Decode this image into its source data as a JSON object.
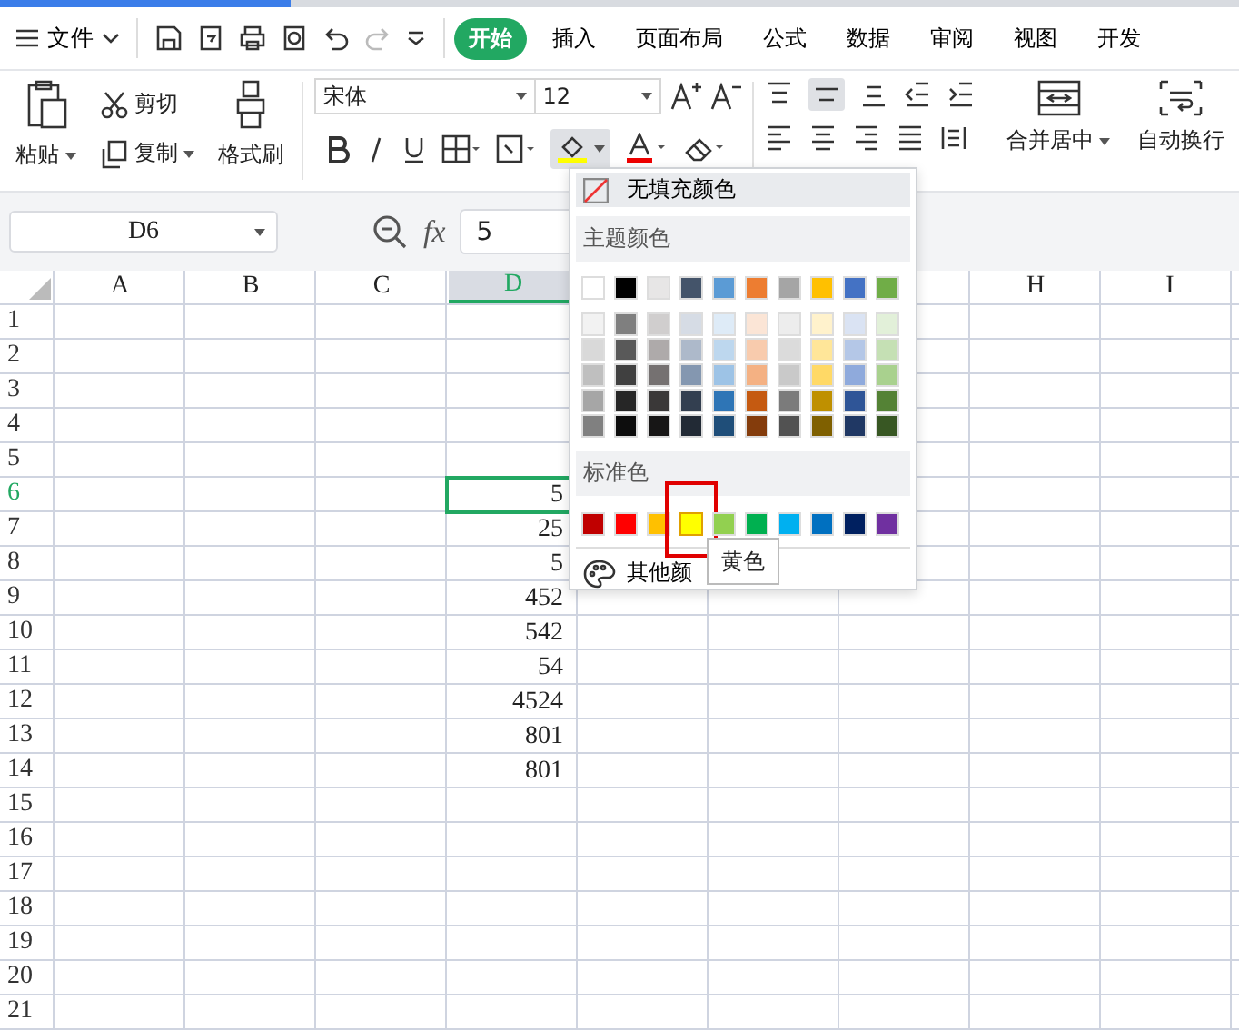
{
  "top_bar": {
    "file_menu": "文件",
    "tabs": [
      {
        "label": "开始",
        "selected": true
      },
      {
        "label": "插入",
        "selected": false
      },
      {
        "label": "页面布局",
        "selected": false
      },
      {
        "label": "公式",
        "selected": false
      },
      {
        "label": "数据",
        "selected": false
      },
      {
        "label": "审阅",
        "selected": false
      },
      {
        "label": "视图",
        "selected": false
      },
      {
        "label": "开发",
        "selected": false
      }
    ]
  },
  "ribbon": {
    "paste": "粘贴",
    "cut": "剪切",
    "copy": "复制",
    "format_painter": "格式刷",
    "font": "宋体",
    "font_size": "12",
    "fill_color_pressed": true,
    "merge": "合并居中",
    "wrap": "自动换行"
  },
  "formula_bar": {
    "cell_ref": "D6",
    "fx": "fx",
    "value": "5"
  },
  "grid": {
    "columns": [
      {
        "label": "A",
        "selected": false
      },
      {
        "label": "B",
        "selected": false
      },
      {
        "label": "C",
        "selected": false
      },
      {
        "label": "D",
        "selected": true
      },
      {
        "label": "H",
        "selected": false
      },
      {
        "label": "I",
        "selected": false
      }
    ],
    "rows": [
      {
        "label": "1",
        "selected": false
      },
      {
        "label": "2",
        "selected": false
      },
      {
        "label": "3",
        "selected": false
      },
      {
        "label": "4",
        "selected": false
      },
      {
        "label": "5",
        "selected": false
      },
      {
        "label": "6",
        "selected": true,
        "d": "5"
      },
      {
        "label": "7",
        "selected": false,
        "d": "25"
      },
      {
        "label": "8",
        "selected": false,
        "d": "5"
      },
      {
        "label": "9",
        "selected": false,
        "d": "452"
      },
      {
        "label": "10",
        "selected": false,
        "d": "542"
      },
      {
        "label": "11",
        "selected": false,
        "d": "54"
      },
      {
        "label": "12",
        "selected": false,
        "d": "4524"
      },
      {
        "label": "13",
        "selected": false,
        "d": "801"
      },
      {
        "label": "14",
        "selected": false,
        "d": "801"
      },
      {
        "label": "15",
        "selected": false
      },
      {
        "label": "16",
        "selected": false
      },
      {
        "label": "17",
        "selected": false
      },
      {
        "label": "18",
        "selected": false
      },
      {
        "label": "19",
        "selected": false
      },
      {
        "label": "20",
        "selected": false
      },
      {
        "label": "21",
        "selected": false
      }
    ]
  },
  "fill_popup": {
    "no_fill": "无填充颜色",
    "theme_heading": "主题颜色",
    "theme_colors": [
      {
        "color": "#ffffff"
      },
      {
        "color": "#000000"
      },
      {
        "color": "#e7e6e6"
      },
      {
        "color": "#44546a"
      },
      {
        "color": "#5b9bd5"
      },
      {
        "color": "#ed7d31"
      },
      {
        "color": "#a5a5a5"
      },
      {
        "color": "#ffc000"
      },
      {
        "color": "#4472c4"
      },
      {
        "color": "#70ad47"
      }
    ],
    "tints": [
      [
        {
          "color": "#f2f2f2"
        },
        {
          "color": "#7f7f7f"
        },
        {
          "color": "#d0cece"
        },
        {
          "color": "#d6dce5"
        },
        {
          "color": "#deebf7"
        },
        {
          "color": "#fbe5d6"
        },
        {
          "color": "#ededed"
        },
        {
          "color": "#fff2cc"
        },
        {
          "color": "#dae3f3"
        },
        {
          "color": "#e2f0d9"
        }
      ],
      [
        {
          "color": "#d9d9d9"
        },
        {
          "color": "#595959"
        },
        {
          "color": "#aeaaaa"
        },
        {
          "color": "#adb9ca"
        },
        {
          "color": "#bdd7ee"
        },
        {
          "color": "#f8cbad"
        },
        {
          "color": "#dbdbdb"
        },
        {
          "color": "#ffe699"
        },
        {
          "color": "#b4c7e7"
        },
        {
          "color": "#c5e0b4"
        }
      ],
      [
        {
          "color": "#bfbfbf"
        },
        {
          "color": "#404040"
        },
        {
          "color": "#757171"
        },
        {
          "color": "#8497b0"
        },
        {
          "color": "#9dc3e6"
        },
        {
          "color": "#f4b183"
        },
        {
          "color": "#c9c9c9"
        },
        {
          "color": "#ffd966"
        },
        {
          "color": "#8faadc"
        },
        {
          "color": "#a9d18e"
        }
      ],
      [
        {
          "color": "#a6a6a6"
        },
        {
          "color": "#262626"
        },
        {
          "color": "#3a3838"
        },
        {
          "color": "#333f50"
        },
        {
          "color": "#2e75b6"
        },
        {
          "color": "#c55a11"
        },
        {
          "color": "#7b7b7b"
        },
        {
          "color": "#bf9000"
        },
        {
          "color": "#2f5597"
        },
        {
          "color": "#548235"
        }
      ],
      [
        {
          "color": "#808080"
        },
        {
          "color": "#0d0d0d"
        },
        {
          "color": "#171616"
        },
        {
          "color": "#222a35"
        },
        {
          "color": "#1f4e79"
        },
        {
          "color": "#843c0c"
        },
        {
          "color": "#525252"
        },
        {
          "color": "#7f6000"
        },
        {
          "color": "#203864"
        },
        {
          "color": "#385723"
        }
      ]
    ],
    "standard_heading": "标准色",
    "standard_colors": [
      {
        "color": "#c00000",
        "selected": false
      },
      {
        "color": "#ff0000",
        "selected": false
      },
      {
        "color": "#ffc000",
        "selected": false
      },
      {
        "color": "#ffff00",
        "selected": true
      },
      {
        "color": "#92d050",
        "selected": false
      },
      {
        "color": "#00b050",
        "selected": false
      },
      {
        "color": "#00b0f0",
        "selected": false
      },
      {
        "color": "#0070c0",
        "selected": false
      },
      {
        "color": "#002060",
        "selected": false
      },
      {
        "color": "#7030a0",
        "selected": false
      }
    ],
    "more": "其他颜",
    "tooltip": "黄色"
  }
}
